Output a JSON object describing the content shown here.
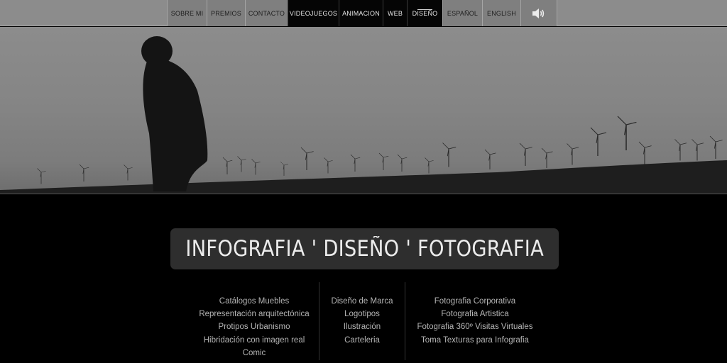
{
  "nav": {
    "items": [
      {
        "label": "SOBRE MI"
      },
      {
        "label": "PREMIOS"
      },
      {
        "label": "CONTACTO"
      },
      {
        "label": "VIDEOJUEGOS"
      },
      {
        "label": "ANIMACION"
      },
      {
        "label": "WEB"
      },
      {
        "label": "DISEÑO"
      },
      {
        "label": "ESPAÑOL"
      },
      {
        "label": "ENGLISH"
      }
    ],
    "active": "DISEÑO",
    "sound_icon": "speaker-volume-icon"
  },
  "hero": {
    "image": "silhouette-person-wind-turbines-photo"
  },
  "title": "INFOGRAFIA ' DISEÑO ' FOTOGRAFIA",
  "columns": [
    {
      "items": [
        "Catálogos Muebles",
        "Representación arquitectónica",
        "Protipos Urbanismo",
        "Hibridación con imagen real",
        "Comic"
      ]
    },
    {
      "items": [
        "Diseño de Marca",
        "Logotipos",
        "Ilustración",
        "Carteleria"
      ]
    },
    {
      "items": [
        "Fotografia Corporativa",
        "Fotografia Artistica",
        "Fotografia 360º Visitas Virtuales",
        "Toma Texturas para Infografia"
      ]
    }
  ],
  "colors": {
    "topbar": "#8c8c8c",
    "nav_dark": "#050505",
    "title_bg": "#2e2e2e",
    "background": "#000000"
  }
}
